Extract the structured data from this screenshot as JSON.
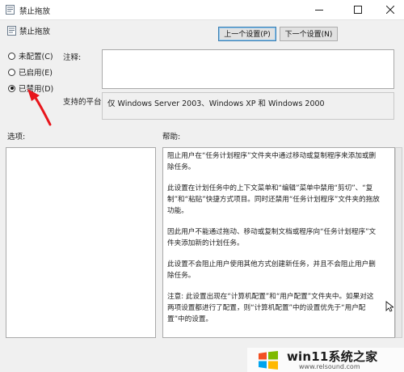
{
  "window": {
    "title": "禁止拖放",
    "setting_name": "禁止拖放"
  },
  "nav": {
    "prev": "上一个设置(P)",
    "next": "下一个设置(N)"
  },
  "radios": [
    {
      "label": "未配置(C)",
      "checked": false
    },
    {
      "label": "已启用(E)",
      "checked": false
    },
    {
      "label": "已禁用(D)",
      "checked": true
    }
  ],
  "labels": {
    "comment": "注释:",
    "supported": "支持的平台:",
    "options": "选项:",
    "help": "帮助:"
  },
  "supported_value": "仅 Windows Server 2003、Windows XP 和 Windows 2000",
  "help_paragraphs": [
    "阻止用户在“任务计划程序”文件夹中通过移动或复制程序来添加或删除任务。",
    "此设置在计划任务中的上下文菜单和“编辑”菜单中禁用“剪切”、“复制”和“粘贴”快捷方式项目。同时还禁用“任务计划程序”文件夹的拖放功能。",
    "因此用户不能通过拖动、移动或复制文档或程序向“任务计划程序”文件夹添加新的计划任务。",
    "此设置不会阻止用户使用其他方式创建新任务，并且不会阻止用户删除任务。",
    "注意: 此设置出现在“计算机配置”和“用户配置”文件夹中。如果对这两项设置都进行了配置，则“计算机配置”中的设置优先于“用户配置”中的设置。"
  ],
  "watermark": {
    "text": "win11系统之家",
    "url": "www.relsound.com"
  },
  "colors": {
    "accent": "#3c7fb1",
    "annotation_arrow": "#e8151b"
  },
  "icons": [
    "policy-icon",
    "minimize-icon",
    "maximize-icon",
    "close-icon"
  ]
}
